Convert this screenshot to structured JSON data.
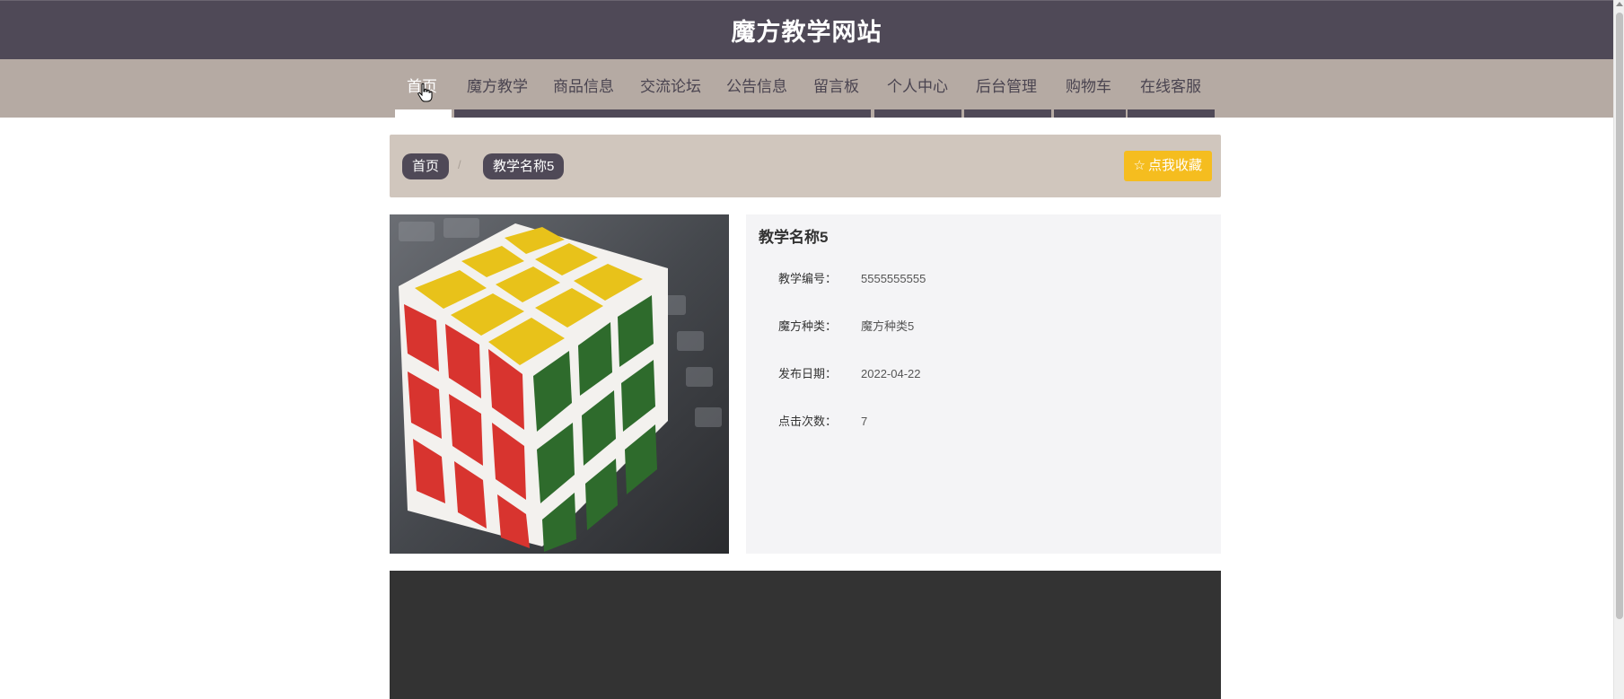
{
  "header": {
    "title": "魔方教学网站"
  },
  "nav": {
    "items": [
      {
        "label": "首页"
      },
      {
        "label": "魔方教学"
      },
      {
        "label": "商品信息"
      },
      {
        "label": "交流论坛"
      },
      {
        "label": "公告信息"
      },
      {
        "label": "留言板"
      },
      {
        "label": "个人中心"
      },
      {
        "label": "后台管理"
      },
      {
        "label": "购物车"
      },
      {
        "label": "在线客服"
      }
    ]
  },
  "breadcrumb": {
    "home": "首页",
    "separator": "/",
    "current": "教学名称5"
  },
  "favorite_button": {
    "label": "点我收藏",
    "icon": "star-outline-icon"
  },
  "detail": {
    "title": "教学名称5",
    "fields": [
      {
        "label": "教学编号：",
        "value": "5555555555"
      },
      {
        "label": "魔方种类：",
        "value": "魔方种类5"
      },
      {
        "label": "发布日期：",
        "value": "2022-04-22"
      },
      {
        "label": "点击次数：",
        "value": "7"
      }
    ]
  },
  "colors": {
    "header_bg": "#4f4957",
    "nav_bg": "#b5aaa3",
    "breadcrumb_bg": "#d0c6bd",
    "accent": "#f5bd1f",
    "footer_bg": "#333333"
  }
}
